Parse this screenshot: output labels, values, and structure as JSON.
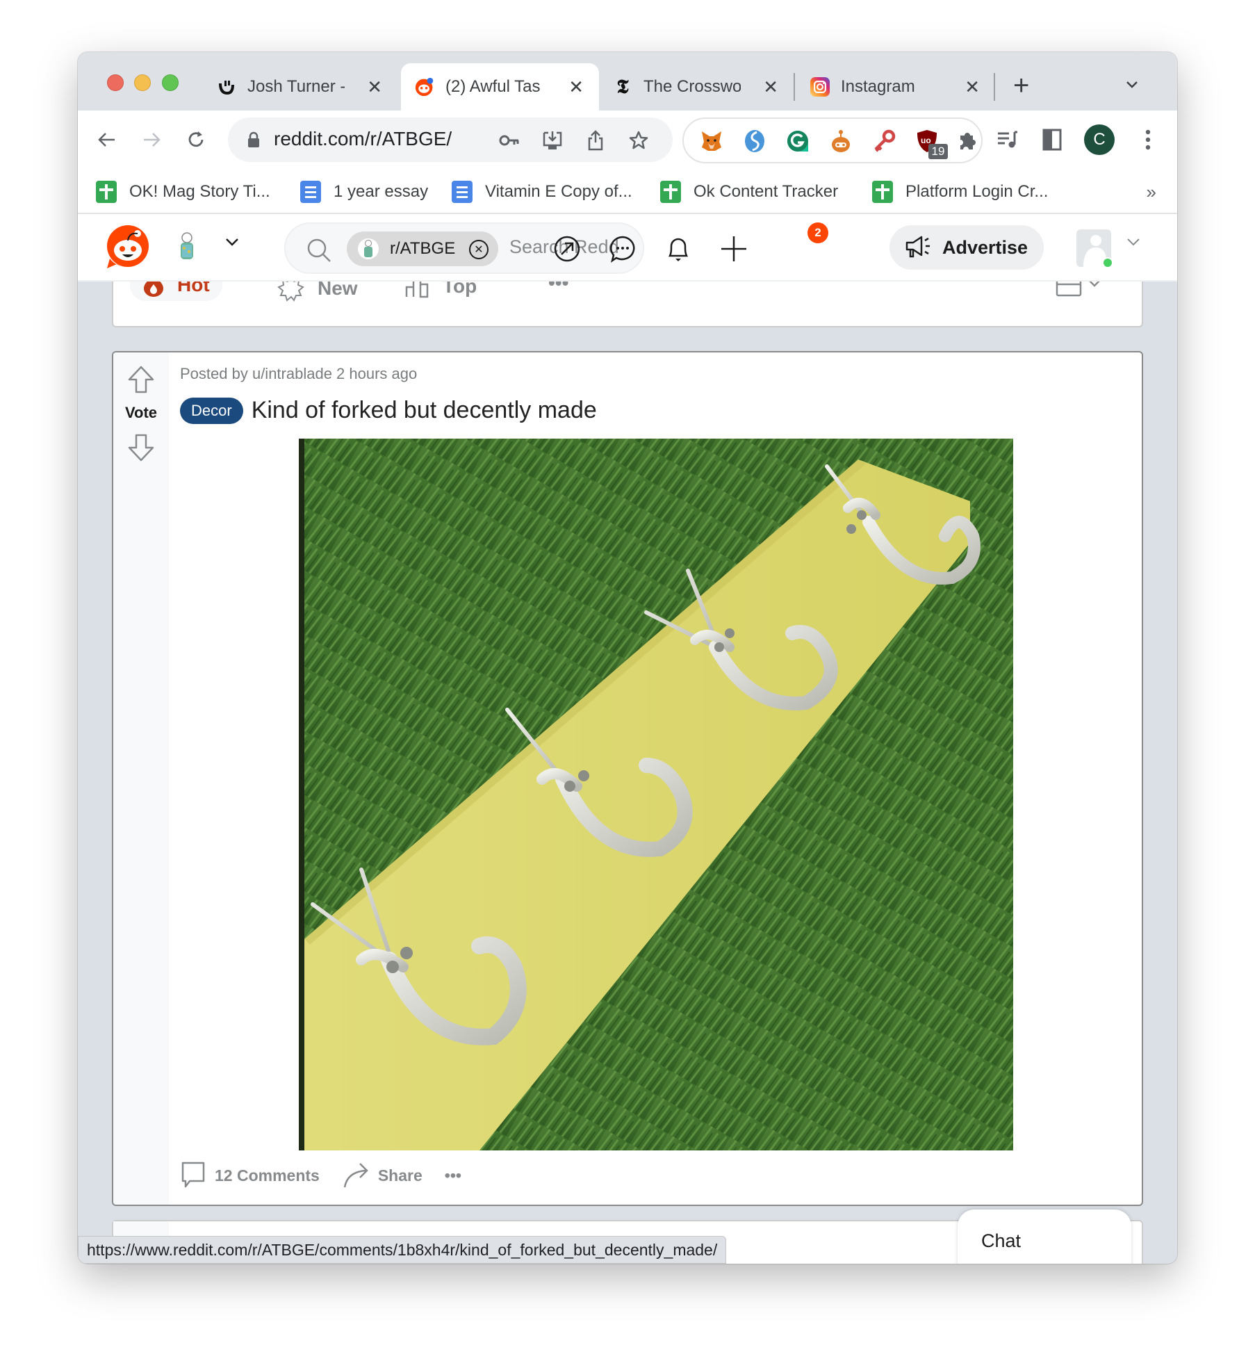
{
  "browser": {
    "tabs": [
      {
        "title": "Josh Turner -",
        "icon": "smile-logo-icon",
        "active": false
      },
      {
        "title": "(2) Awful Tas",
        "icon": "reddit-icon",
        "active": true
      },
      {
        "title": "The Crosswo",
        "icon": "nyt-icon",
        "active": false
      },
      {
        "title": "Instagram",
        "icon": "instagram-icon",
        "active": false
      }
    ],
    "new_tab_label": "+",
    "tab_search_label": "⌄",
    "close_glyph": "✕",
    "address": "reddit.com/r/ATBGE/",
    "extensions": [
      {
        "name": "metamask-extension",
        "badge": ""
      },
      {
        "name": "simplenote-extension",
        "badge": ""
      },
      {
        "name": "grammarly-extension",
        "badge": ""
      },
      {
        "name": "bot-extension",
        "badge": ""
      },
      {
        "name": "key-extension",
        "badge": ""
      },
      {
        "name": "ublock-extension",
        "badge": "19"
      },
      {
        "name": "extensions-puzzle",
        "badge": ""
      }
    ],
    "profile_initial": "C",
    "bookmarks": [
      {
        "label": "OK! Mag Story Ti...",
        "type": "sheet"
      },
      {
        "label": "1 year essay",
        "type": "doc"
      },
      {
        "label": "Vitamin E Copy of...",
        "type": "doc"
      },
      {
        "label": "Ok Content Tracker",
        "type": "sheet"
      },
      {
        "label": "Platform Login Cr...",
        "type": "sheet"
      }
    ],
    "bookmarks_more": "»",
    "status_url": "https://www.reddit.com/r/ATBGE/comments/1b8xh4r/kind_of_forked_but_decently_made/"
  },
  "reddit": {
    "search": {
      "chip_label": "r/ATBGE",
      "placeholder": "Search Redd"
    },
    "notification_count": "2",
    "advertise_label": "Advertise",
    "sort": {
      "hot": "Hot",
      "new": "New",
      "top": "Top",
      "more": "•••"
    },
    "post": {
      "vote_label": "Vote",
      "meta": "Posted by u/intrablade 2 hours ago",
      "flair": "Decor",
      "title": "Kind of forked but decently made",
      "image_alt": "Yellow wooden board with four bent fork hooks lying on grass",
      "comments_label": "12 Comments",
      "share_label": "Share",
      "more_label": "•••"
    },
    "chat_label": "Chat"
  },
  "colors": {
    "reddit_orange": "#ff4500",
    "flair_bg": "#1b4a7e",
    "page_bg": "#dae0e6"
  }
}
